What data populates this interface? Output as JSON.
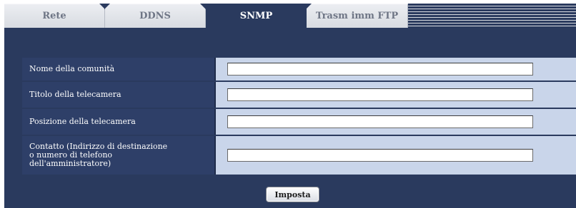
{
  "tabs": [
    {
      "label": "Rete",
      "active": false
    },
    {
      "label": "DDNS",
      "active": false
    },
    {
      "label": "SNMP",
      "active": true
    },
    {
      "label": "Trasm imm FTP",
      "active": false
    }
  ],
  "form": {
    "fields": [
      {
        "label": "Nome della comunità",
        "value": ""
      },
      {
        "label": "Titolo della telecamera",
        "value": ""
      },
      {
        "label": "Posizione della telecamera",
        "value": ""
      },
      {
        "label": "Contatto (Indirizzo di destinazione\no numero di telefono\ndell'amministratore)",
        "value": ""
      }
    ],
    "submit_label": "Imposta"
  },
  "colors": {
    "panel": "#2a3a5e",
    "label_bg": "#2e3f68",
    "value_bg": "#c9d5ea",
    "tab_inactive": "#d8dbe1"
  }
}
